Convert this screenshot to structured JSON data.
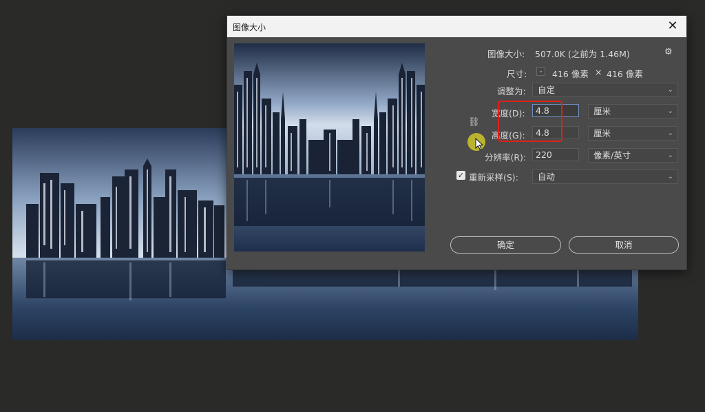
{
  "dialog": {
    "title": "图像大小",
    "image_size_label": "图像大小:",
    "image_size_value": "507.0K (之前为 1.46M)",
    "dimensions_label": "尺寸:",
    "dimensions_width": "416 像素",
    "dimensions_times": "×",
    "dimensions_height": "416 像素",
    "fit_label": "调整为:",
    "fit_value": "自定",
    "width_label": "宽度(D):",
    "width_value": "4.8",
    "width_unit": "厘米",
    "height_label": "高度(G):",
    "height_value": "4.8",
    "height_unit": "厘米",
    "resolution_label": "分辨率(R):",
    "resolution_value": "220",
    "resolution_unit": "像素/英寸",
    "resample_label": "重新采样(S):",
    "resample_checked": true,
    "resample_value": "自动",
    "ok_label": "确定",
    "cancel_label": "取消",
    "close_glyph": "✕",
    "gear_glyph": "⚙",
    "link_glyph": "⛓",
    "chevron_glyph": "⌄",
    "check_glyph": "✓"
  },
  "colors": {
    "app_background": "#2a2a29",
    "dialog_background": "#4a4a4a",
    "titlebar": "#f2f2f2",
    "highlight": "#e0211a",
    "cursor_highlight": "#d6cd28"
  }
}
